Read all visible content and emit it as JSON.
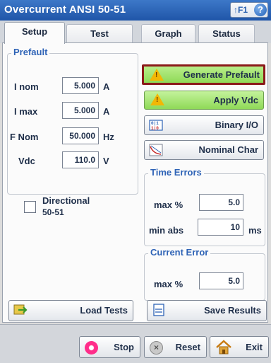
{
  "window": {
    "title": "Overcurrent ANSI 50-51",
    "help_label": "↑F1"
  },
  "tabs": [
    {
      "label": "Setup"
    },
    {
      "label": "Test"
    },
    {
      "label": "Graph"
    },
    {
      "label": "Status"
    }
  ],
  "prefault": {
    "legend": "Prefault",
    "rows": [
      {
        "label": "I nom",
        "value": "5.000",
        "unit": "A"
      },
      {
        "label": "I max",
        "value": "5.000",
        "unit": "A"
      },
      {
        "label": "F Nom",
        "value": "50.000",
        "unit": "Hz"
      },
      {
        "label": "Vdc",
        "value": "110.0",
        "unit": "V"
      }
    ]
  },
  "directional": {
    "label_line1": "Directional",
    "label_line2": "50-51",
    "checked": false
  },
  "actions": {
    "generate_prefault": "Generate Prefault",
    "apply_vdc": "Apply Vdc",
    "binary_io": "Binary I/O",
    "nominal_char": "Nominal Char"
  },
  "time_errors": {
    "legend": "Time Errors",
    "max_label": "max %",
    "max_value": "5.0",
    "min_label": "min abs",
    "min_value": "10",
    "min_unit": "ms"
  },
  "current_error": {
    "legend": "Current Error",
    "max_label": "max %",
    "max_value": "5.0"
  },
  "file_buttons": {
    "load_tests": "Load Tests",
    "save_results": "Save Results"
  },
  "bottom": {
    "stop": "Stop",
    "reset": "Reset",
    "exit": "Exit"
  },
  "colors": {
    "title_bar": "#1f55a8",
    "accent_text": "#2e63b6",
    "warning_frame": "#8b1a1a",
    "action_green": "#8fd957"
  },
  "icons": [
    "help-icon",
    "warning-icon",
    "binary-io-icon",
    "chart-icon",
    "load-icon",
    "save-icon",
    "stop-icon",
    "reset-icon",
    "home-icon"
  ]
}
